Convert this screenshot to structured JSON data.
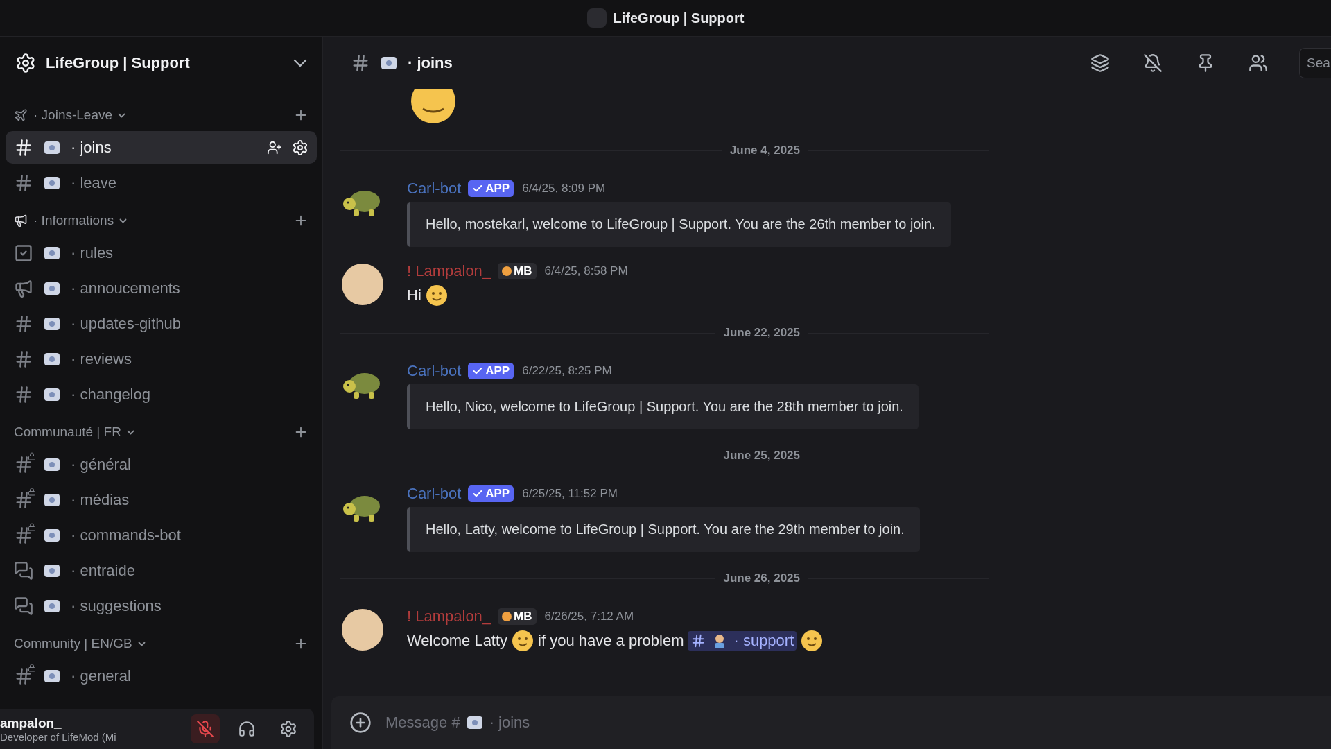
{
  "window": {
    "title": "LifeGroup | Support"
  },
  "server": {
    "name": "LifeGroup | Support"
  },
  "categories": [
    {
      "label": "· Joins-Leave",
      "kind": "plane",
      "channels": [
        {
          "name": "· joins",
          "kind": "text",
          "selected": true
        },
        {
          "name": "· leave",
          "kind": "text",
          "selected": false
        }
      ]
    },
    {
      "label": "· Informations",
      "kind": "megaphone",
      "channels": [
        {
          "name": "· rules",
          "kind": "rules",
          "selected": false
        },
        {
          "name": "· annoucements",
          "kind": "announcement",
          "selected": false
        },
        {
          "name": "· updates-github",
          "kind": "text",
          "selected": false
        },
        {
          "name": "· reviews",
          "kind": "text",
          "selected": false
        },
        {
          "name": "· changelog",
          "kind": "text",
          "selected": false
        }
      ]
    },
    {
      "label": "Communauté | FR",
      "kind": "plain",
      "channels": [
        {
          "name": "· général",
          "kind": "locked",
          "selected": false
        },
        {
          "name": "· médias",
          "kind": "locked",
          "selected": false
        },
        {
          "name": "· commands-bot",
          "kind": "locked",
          "selected": false
        },
        {
          "name": "· entraide",
          "kind": "forum",
          "selected": false
        },
        {
          "name": "· suggestions",
          "kind": "forum",
          "selected": false
        }
      ]
    },
    {
      "label": "Community | EN/GB",
      "kind": "plain",
      "channels": [
        {
          "name": "· general",
          "kind": "locked",
          "selected": false
        }
      ]
    }
  ],
  "user": {
    "name": "ampalon_",
    "status": "Developer of LifeMod (Mi",
    "muted": true
  },
  "channel_header": {
    "name": "· joins"
  },
  "search": {
    "placeholder": "Sea"
  },
  "feed": [
    {
      "kind": "emoji-tail"
    },
    {
      "kind": "date",
      "text": "June 4, 2025"
    },
    {
      "kind": "message",
      "author": "Carl-bot",
      "color": "#4a72bd",
      "badge": {
        "kind": "app",
        "label": "APP"
      },
      "time": "6/4/25, 8:09 PM",
      "embed": "Hello, mostekarl, welcome to LifeGroup | Support. You are the 26th member to join."
    },
    {
      "kind": "message",
      "author": "! Lampalon_",
      "color": "#b23c3c",
      "badge": {
        "kind": "role",
        "label": "MB"
      },
      "time": "6/4/25, 8:58 PM",
      "content": [
        {
          "kind": "text",
          "text": "Hi"
        },
        {
          "kind": "emoji"
        }
      ]
    },
    {
      "kind": "date",
      "text": "June 22, 2025"
    },
    {
      "kind": "message",
      "author": "Carl-bot",
      "color": "#4a72bd",
      "badge": {
        "kind": "app",
        "label": "APP"
      },
      "time": "6/22/25, 8:25 PM",
      "embed": "Hello, Nico, welcome to LifeGroup | Support. You are the 28th member to join."
    },
    {
      "kind": "date",
      "text": "June 25, 2025"
    },
    {
      "kind": "message",
      "author": "Carl-bot",
      "color": "#4a72bd",
      "badge": {
        "kind": "app",
        "label": "APP"
      },
      "time": "6/25/25, 11:52 PM",
      "embed": "Hello, Latty, welcome to LifeGroup | Support. You are the 29th member to join."
    },
    {
      "kind": "date",
      "text": "June 26, 2025"
    },
    {
      "kind": "message",
      "author": "! Lampalon_",
      "color": "#b23c3c",
      "badge": {
        "kind": "role",
        "label": "MB"
      },
      "time": "6/26/25, 7:12 AM",
      "content": [
        {
          "kind": "text",
          "text": "Welcome Latty"
        },
        {
          "kind": "emoji"
        },
        {
          "kind": "text",
          "text": "if you have a problem"
        },
        {
          "kind": "mention",
          "text": "· support"
        },
        {
          "kind": "emoji"
        }
      ]
    }
  ],
  "composer": {
    "placeholder": "Message #",
    "channel": "· joins"
  }
}
